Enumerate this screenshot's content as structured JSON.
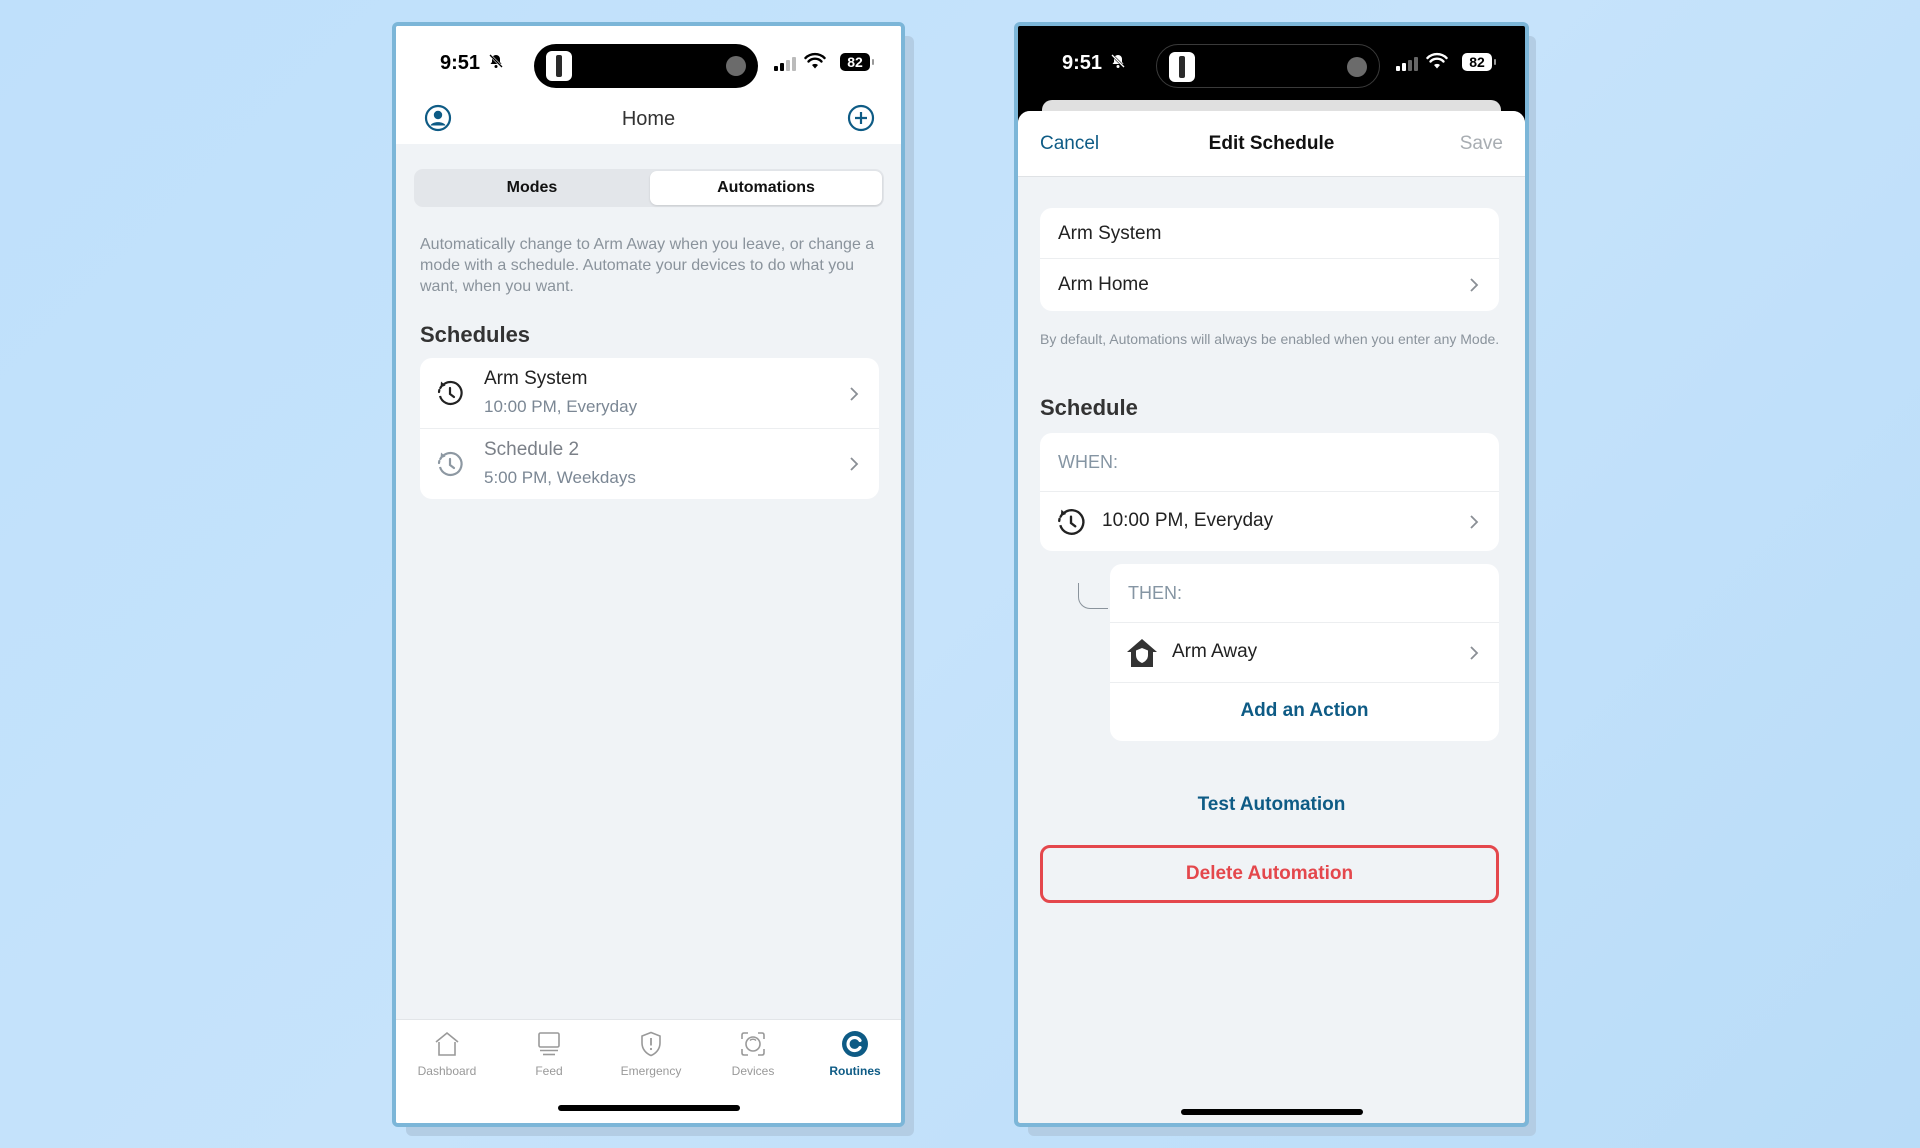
{
  "status_bar": {
    "time": "9:51",
    "battery": "82",
    "icons": [
      "bell-slash-icon",
      "signal-icon",
      "wifi-icon",
      "battery-icon"
    ]
  },
  "left_screen": {
    "nav": {
      "title": "Home",
      "left_icon": "profile-icon",
      "right_icon": "add-circle-icon"
    },
    "segments": {
      "options": [
        "Modes",
        "Automations"
      ],
      "selected": "Automations"
    },
    "description": "Automatically change to Arm Away when you leave, or change a mode with a schedule. Automate your devices to do what you want, when you want.",
    "schedules_title": "Schedules",
    "schedules": [
      {
        "title": "Arm System",
        "subtitle": "10:00 PM, Everyday",
        "enabled": true
      },
      {
        "title": "Schedule 2",
        "subtitle": "5:00 PM, Weekdays",
        "enabled": false
      }
    ],
    "tabbar": [
      {
        "label": "Dashboard",
        "icon": "house-icon"
      },
      {
        "label": "Feed",
        "icon": "monitor-icon"
      },
      {
        "label": "Emergency",
        "icon": "shield-alert-icon"
      },
      {
        "label": "Devices",
        "icon": "camera-frame-icon"
      },
      {
        "label": "Routines",
        "icon": "routines-icon",
        "active": true
      }
    ]
  },
  "right_screen": {
    "header": {
      "cancel": "Cancel",
      "title": "Edit Schedule",
      "save": "Save"
    },
    "name_field": "Arm System",
    "mode_field": "Arm Home",
    "note": "By default, Automations will always be enabled when you enter any Mode.",
    "schedule_title": "Schedule",
    "when_label": "WHEN:",
    "when_value": "10:00 PM, Everyday",
    "then_label": "THEN:",
    "then_value": "Arm Away",
    "add_action": "Add an Action",
    "test_automation": "Test Automation",
    "delete_automation": "Delete Automation"
  },
  "colors": {
    "accent": "#0e5b85",
    "danger": "#e4474c",
    "frame": "#7cb6d8",
    "background": "#c2e1fb"
  }
}
